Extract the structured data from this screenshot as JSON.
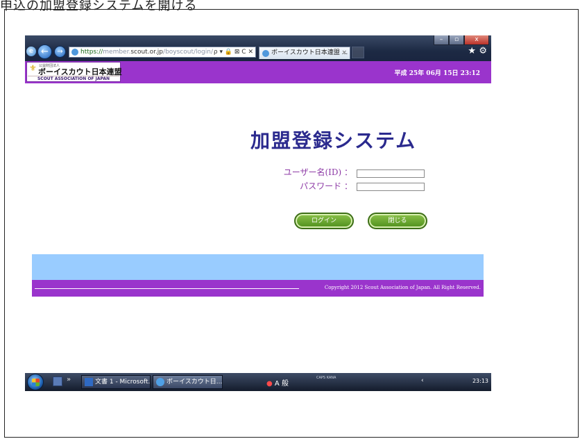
{
  "document": {
    "caption": "申込の加盟登録システムを開ける"
  },
  "browser": {
    "address": {
      "scheme": "https://",
      "host_dim": "member.",
      "host": "scout.or.jp",
      "path": "/boyscout/login/"
    },
    "address_tools": "ρ ▾ 🔒 ⊠ C ✕",
    "tab_title": "ボーイスカウト日本連盟 ...",
    "tab_close": "×",
    "window_controls": {
      "minimize": "–",
      "maximize": "▫",
      "close": "x"
    },
    "icons": {
      "favorites": "★",
      "tools": "⚙",
      "back": "←",
      "forward": "→",
      "ie": "e"
    }
  },
  "header": {
    "logo_small": "公益財団法人",
    "logo_name": "ボーイスカウト日本連盟",
    "logo_english": "SCOUT ASSOCIATION OF JAPAN",
    "logo_mark": "⚜",
    "datetime": "平成 25年 06月 15日 23:12"
  },
  "login": {
    "title": "加盟登録システム",
    "user_label": "ユーザー名(ID) ：",
    "password_label": "パスワード ：",
    "user_value": "",
    "password_value": "",
    "login_button": "ログイン",
    "close_button": "閉じる"
  },
  "footer": {
    "copyright": "Copyright 2012 Scout Association of Japan. All Right Reserved."
  },
  "taskbar": {
    "quick_launch_chevron": "»",
    "task1": "文書 1 - Microsoft...",
    "task2": "ボーイスカウト日...",
    "ime": {
      "mark": "●",
      "mode": "A 般"
    },
    "caps": "CAPS\nKANA",
    "tray": "‹",
    "clock": "23:13"
  },
  "colors": {
    "header_purple": "#9a34cc",
    "light_band": "#99ccff",
    "title_navy": "#2b2a8e",
    "label_purple": "#8d3aa6",
    "button_green": "#5f9f28"
  }
}
